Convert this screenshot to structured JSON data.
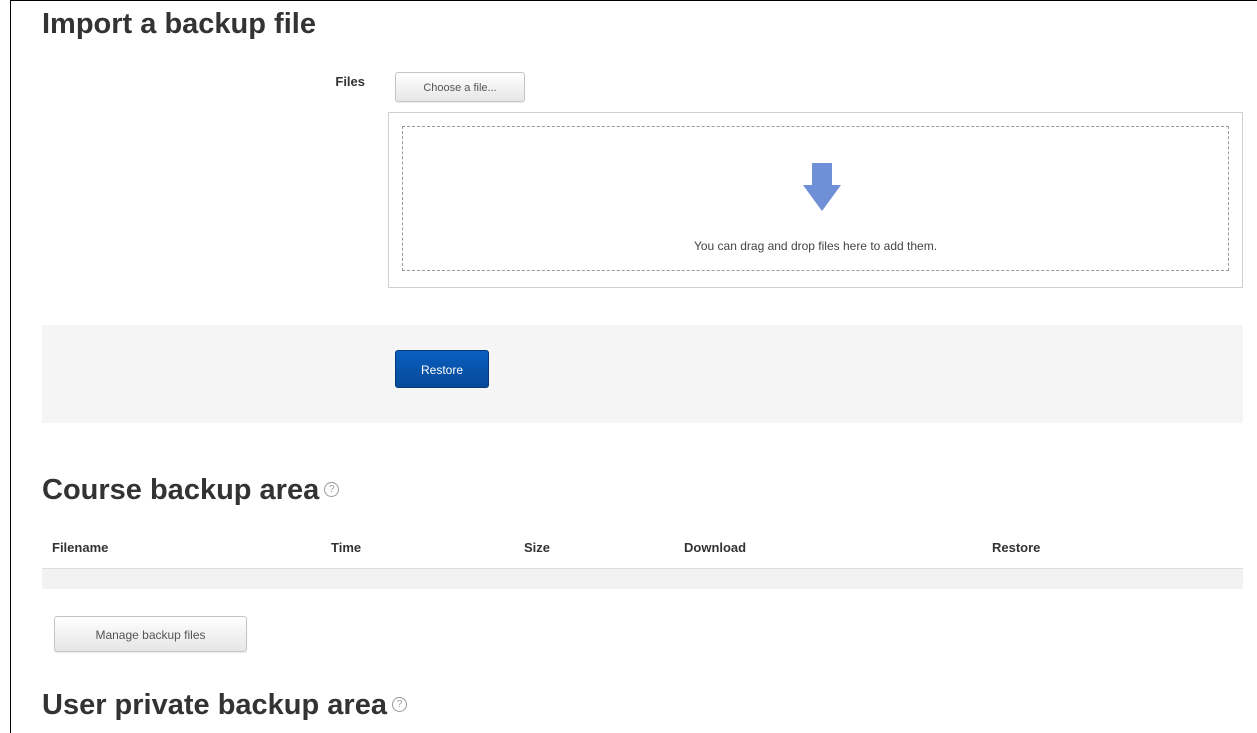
{
  "import_section": {
    "title": "Import a backup file",
    "files_label": "Files",
    "choose_button": "Choose a file...",
    "drop_hint": "You can drag and drop files here to add them.",
    "restore_button": "Restore"
  },
  "course_backup": {
    "title": "Course backup area",
    "columns": [
      "Filename",
      "Time",
      "Size",
      "Download",
      "Restore"
    ],
    "rows": [],
    "manage_button": "Manage backup files"
  },
  "user_backup": {
    "title": "User private backup area"
  },
  "colors": {
    "primary_button": "#0a5fc0",
    "drop_arrow": "#6f8fd6"
  },
  "icons": {
    "help": "help-icon",
    "drop": "down-arrow-icon"
  }
}
